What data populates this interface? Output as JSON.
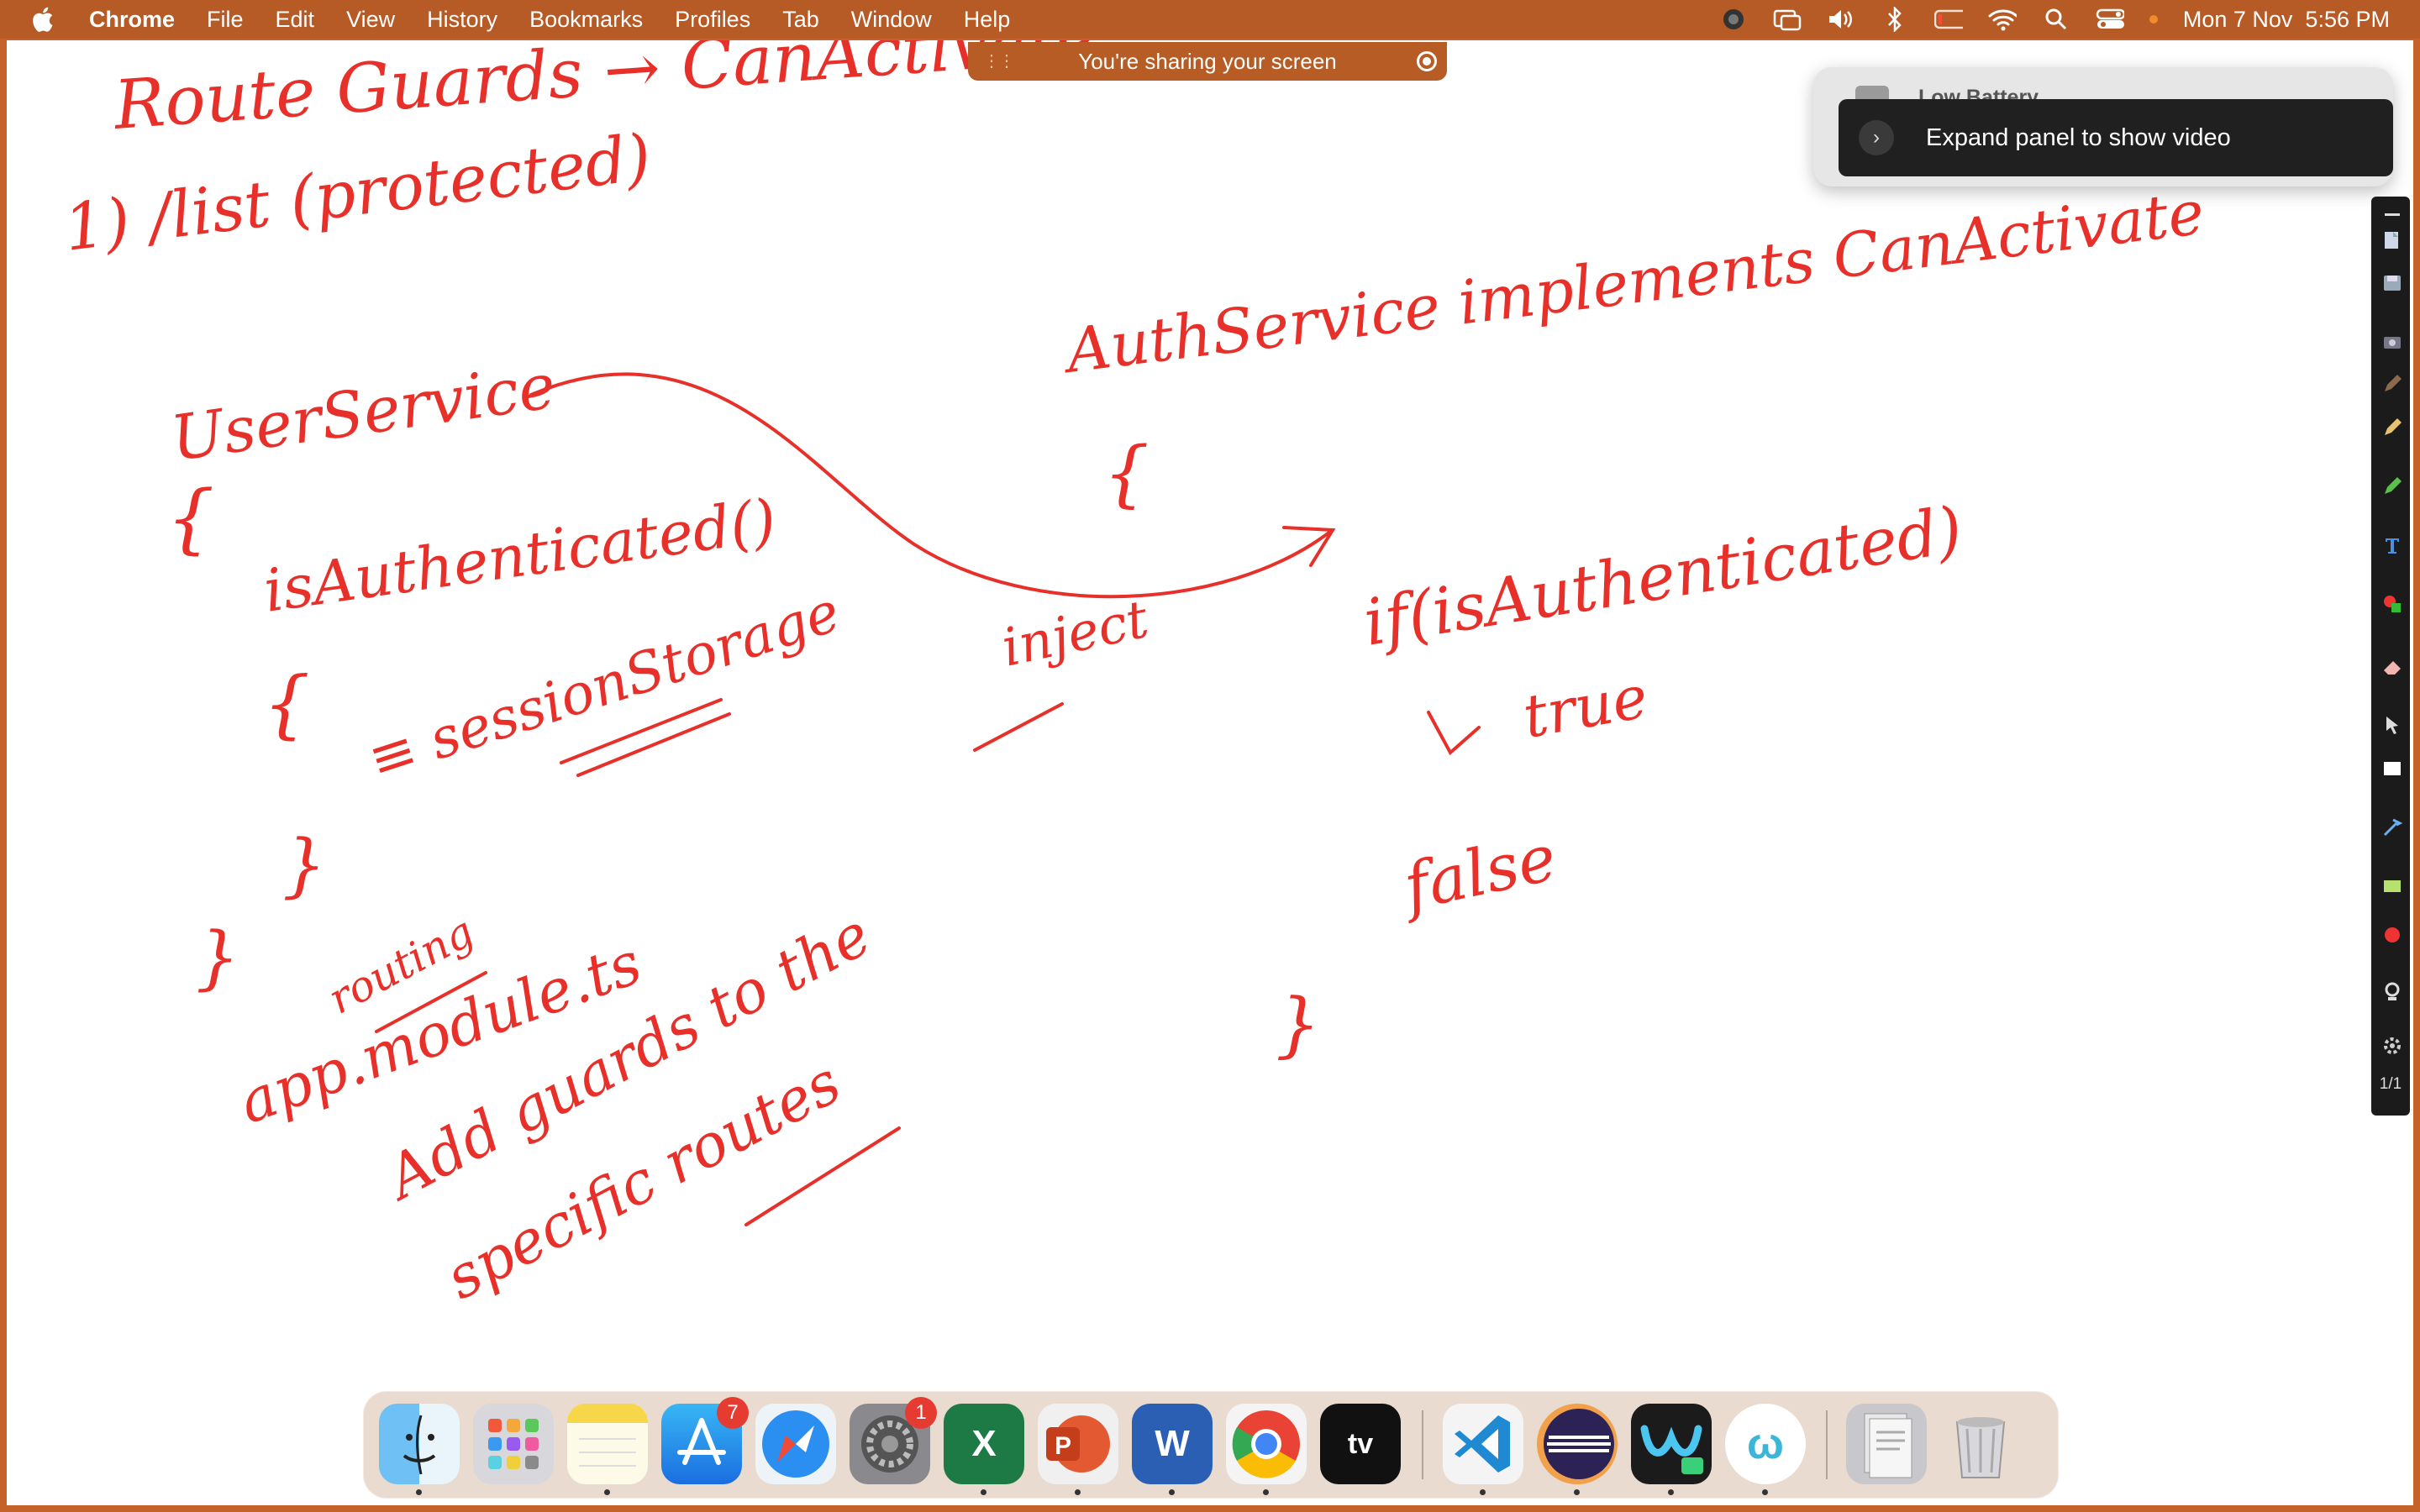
{
  "menubar": {
    "app": "Chrome",
    "items": [
      "File",
      "Edit",
      "View",
      "History",
      "Bookmarks",
      "Profiles",
      "Tab",
      "Window",
      "Help"
    ],
    "datetime": "Mon 7 Nov  5:56 PM"
  },
  "share_banner": {
    "text": "You're sharing your screen"
  },
  "notification": {
    "title": "Low Battery",
    "expand_label": "Expand panel to show video"
  },
  "annotation_toolbar": {
    "page_indicator": "1/1"
  },
  "whiteboard": {
    "ink_color": "#e8302a",
    "notes": [
      "Route Guards → CanActivate",
      "1) /list (protected)",
      "UserService",
      "{",
      "isAuthenticated()",
      "{",
      "≡ sessionStorage",
      "}",
      "}",
      "routing",
      "app.module.ts",
      "Add guards to the",
      "specific routes",
      "inject",
      "AuthService implements CanActivate",
      "{",
      "if(isAuthenticated)",
      "true",
      "false",
      "}"
    ]
  },
  "dock": {
    "apps": [
      {
        "name": "Finder",
        "running": true
      },
      {
        "name": "Launchpad",
        "running": false
      },
      {
        "name": "Notes",
        "running": true
      },
      {
        "name": "App Store",
        "badge": "7",
        "running": false
      },
      {
        "name": "Safari",
        "running": false
      },
      {
        "name": "System Preferences",
        "badge": "1",
        "running": false
      },
      {
        "name": "Microsoft Excel",
        "running": true
      },
      {
        "name": "Microsoft PowerPoint",
        "running": true
      },
      {
        "name": "Microsoft Word",
        "running": true
      },
      {
        "name": "Google Chrome",
        "running": true
      },
      {
        "name": "Apple TV",
        "running": false
      },
      {
        "name": "Visual Studio Code",
        "running": true
      },
      {
        "name": "Eclipse",
        "running": true
      },
      {
        "name": "Webex",
        "running": true
      },
      {
        "name": "Whiteboard",
        "running": true
      },
      {
        "name": "Documents",
        "running": false
      },
      {
        "name": "Trash",
        "running": false
      }
    ]
  }
}
